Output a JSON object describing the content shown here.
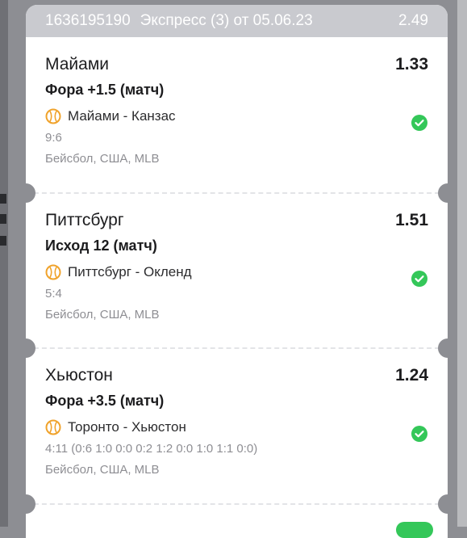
{
  "ticket": {
    "id": "1636195190",
    "type": "Экспресс (3) от 05.06.23",
    "total_odds": "2.49"
  },
  "bets": [
    {
      "team": "Майами",
      "odds": "1.33",
      "market": "Фора +1.5 (матч)",
      "match": "Майами - Канзас",
      "score": "9:6",
      "league": "Бейсбол, США, MLB",
      "status": "won"
    },
    {
      "team": "Питтсбург",
      "odds": "1.51",
      "market": "Исход 12 (матч)",
      "match": "Питтсбург - Окленд",
      "score": "5:4",
      "league": "Бейсбол, США, MLB",
      "status": "won"
    },
    {
      "team": "Хьюстон",
      "odds": "1.24",
      "market": "Фора +3.5 (матч)",
      "match": "Торонто - Хьюстон",
      "score": "4:11 (0:6 1:0 0:0 0:2 1:2 0:0 1:0 1:1 0:0)",
      "league": "Бейсбол, США, MLB",
      "status": "won"
    }
  ],
  "icons": {
    "sport": "baseball-icon",
    "status": "check-circle-icon"
  },
  "colors": {
    "header_bg": "#c9cacf",
    "success": "#34c759",
    "ball": "#f0a32c"
  }
}
